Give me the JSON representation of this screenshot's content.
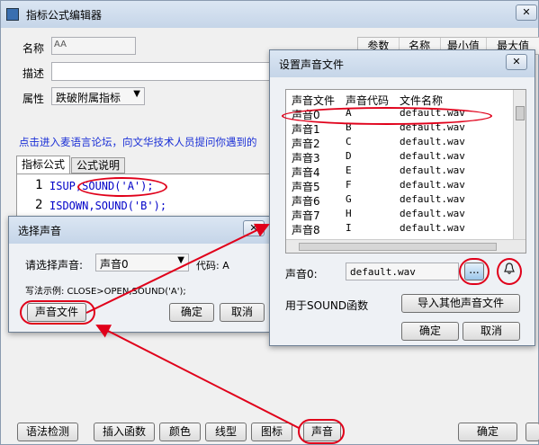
{
  "main": {
    "title": "指标公式编辑器",
    "name_label": "名称",
    "name_value": "AA",
    "desc_label": "描述",
    "attr_label": "属性",
    "attr_value": "跌破附属指标",
    "params_headers": [
      "参数",
      "名称",
      "最小值",
      "最大值"
    ],
    "link_text": "点击进入麦语言论坛，向文华技术人员提问你遇到的",
    "tabs": [
      "指标公式",
      "公式说明"
    ],
    "code_lines": [
      {
        "no": "1",
        "text": "ISUP,SOUND('A');"
      },
      {
        "no": "2",
        "text": "ISDOWN,SOUND('B');"
      }
    ],
    "bottom_buttons": [
      "语法检测",
      "插入函数",
      "颜色",
      "线型",
      "图标",
      "声音"
    ],
    "ok_label": "确定"
  },
  "select_dialog": {
    "title": "选择声音",
    "prompt": "请选择声音:",
    "selected": "声音0",
    "code_label": "代码: A",
    "example": "写法示例: CLOSE>OPEN,SOUND('A');",
    "sound_file_button": "声音文件",
    "ok": "确定",
    "cancel": "取消"
  },
  "settings_dialog": {
    "title": "设置声音文件",
    "headers": [
      "声音文件",
      "声音代码",
      "文件名称"
    ],
    "rows": [
      {
        "name": "声音0",
        "code": "A",
        "file": "default.wav"
      },
      {
        "name": "声音1",
        "code": "B",
        "file": "default.wav"
      },
      {
        "name": "声音2",
        "code": "C",
        "file": "default.wav"
      },
      {
        "name": "声音3",
        "code": "D",
        "file": "default.wav"
      },
      {
        "name": "声音4",
        "code": "E",
        "file": "default.wav"
      },
      {
        "name": "声音5",
        "code": "F",
        "file": "default.wav"
      },
      {
        "name": "声音6",
        "code": "G",
        "file": "default.wav"
      },
      {
        "name": "声音7",
        "code": "H",
        "file": "default.wav"
      },
      {
        "name": "声音8",
        "code": "I",
        "file": "default.wav"
      }
    ],
    "sound_label": "声音0:",
    "sound_file": "default.wav",
    "browse": "...",
    "note": "用于SOUND函数",
    "import_button": "导入其他声音文件",
    "ok": "确定",
    "cancel": "取消"
  },
  "colors": {
    "highlight": "#e0001a",
    "link": "#1a2fd6"
  }
}
